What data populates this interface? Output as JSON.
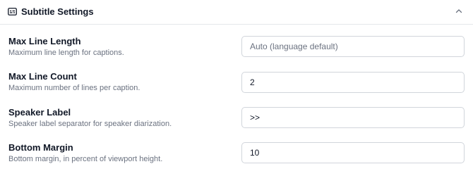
{
  "section": {
    "title": "Subtitle Settings",
    "icon": "subtitles-icon",
    "toggle_icon": "chevron-up-icon"
  },
  "settings": [
    {
      "label": "Max Line Length",
      "description": "Maximum line length for captions.",
      "value": "",
      "placeholder": "Auto (language default)"
    },
    {
      "label": "Max Line Count",
      "description": "Maximum number of lines per caption.",
      "value": "2",
      "placeholder": ""
    },
    {
      "label": "Speaker Label",
      "description": "Speaker label separator for speaker diarization.",
      "value": ">>",
      "placeholder": ""
    },
    {
      "label": "Bottom Margin",
      "description": "Bottom margin, in percent of viewport height.",
      "value": "10",
      "placeholder": ""
    }
  ]
}
